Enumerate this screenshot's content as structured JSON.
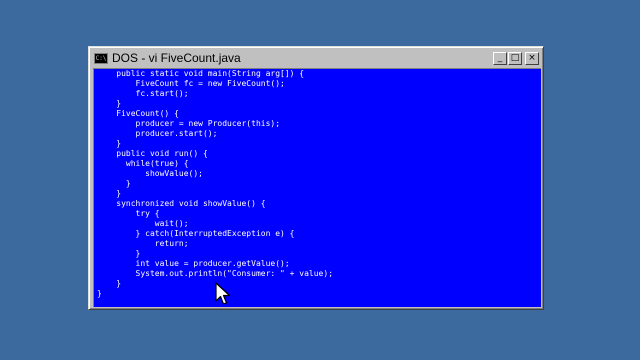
{
  "window": {
    "title": "DOS - vi FiveCount.java",
    "minimize_glyph": "_",
    "maximize_glyph": "□",
    "close_glyph": "×",
    "system_icon": "console-icon"
  },
  "editor": {
    "lines": [
      "    public static void main(String arg[]) {",
      "        FiveCount fc = new FiveCount();",
      "        fc.start();",
      "    }",
      "    FiveCount() {",
      "        producer = new Producer(this);",
      "        producer.start();",
      "    }",
      "    public void run() {",
      "      while(true) {",
      "          showValue();",
      "      }",
      "    }",
      "    synchronized void showValue() {",
      "        try {",
      "            wait();",
      "        } catch(InterruptedException e) {",
      "            return;",
      "        }",
      "        int value = producer.getValue();",
      "        System.out.println(\"Consumer: \" + value);",
      "    }",
      "}"
    ]
  },
  "colors": {
    "desktop": "#3d6a9e",
    "console_bg": "#0000ff",
    "console_text": "#ffffff",
    "chrome": "#c0c0c0"
  }
}
